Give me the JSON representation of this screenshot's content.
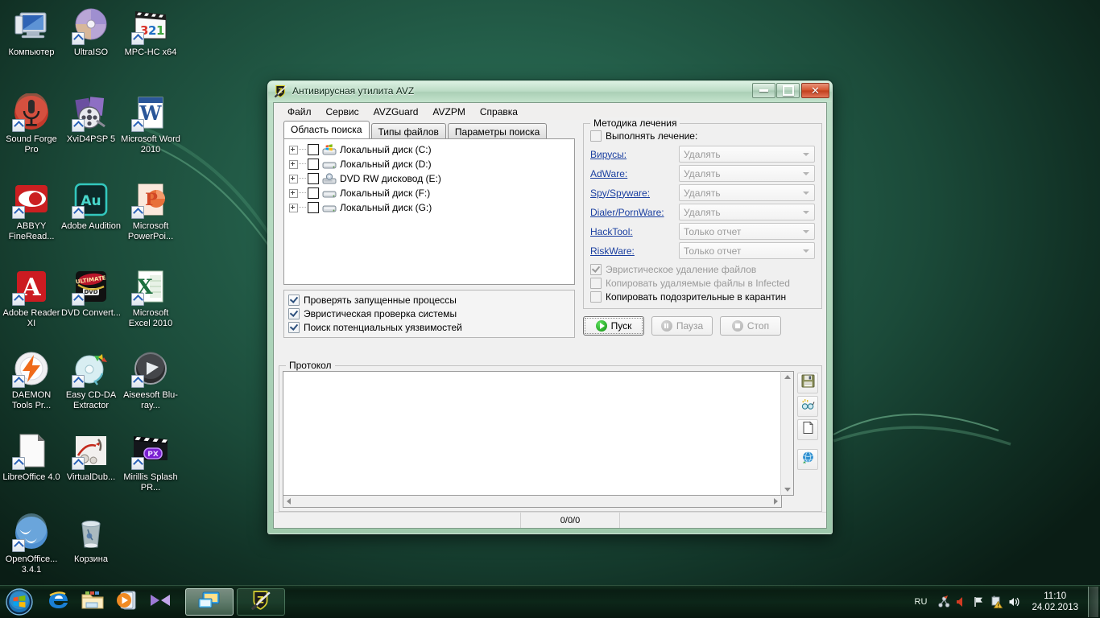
{
  "desktop": {
    "icons": [
      {
        "label": "Компьютер",
        "icon": "computer-icon",
        "shortcut": false
      },
      {
        "label": "UltraISO",
        "icon": "cd-disc-icon",
        "shortcut": true
      },
      {
        "label": "MPC-HC x64",
        "icon": "clapperboard-321-icon",
        "shortcut": true
      },
      {
        "label": "Sound Forge Pro",
        "icon": "microphone-icon",
        "shortcut": true
      },
      {
        "label": "XviD4PSP 5",
        "icon": "film-reel-icon",
        "shortcut": true
      },
      {
        "label": "Microsoft Word 2010",
        "icon": "word-w-icon",
        "shortcut": true
      },
      {
        "label": "ABBYY FineRead...",
        "icon": "abbyy-eye-icon",
        "shortcut": true
      },
      {
        "label": "Adobe Audition",
        "icon": "audition-au-icon",
        "shortcut": true
      },
      {
        "label": "Microsoft PowerPoi...",
        "icon": "powerpoint-p-icon",
        "shortcut": true
      },
      {
        "label": "Adobe Reader XI",
        "icon": "acrobat-a-icon",
        "shortcut": true
      },
      {
        "label": "DVD Convert...",
        "icon": "dvd-box-icon",
        "shortcut": true
      },
      {
        "label": "Microsoft Excel 2010",
        "icon": "excel-x-icon",
        "shortcut": true
      },
      {
        "label": "DAEMON Tools Pr...",
        "icon": "daemon-bolt-icon",
        "shortcut": true
      },
      {
        "label": "Easy CD-DA Extractor",
        "icon": "cd-extract-icon",
        "shortcut": true
      },
      {
        "label": "Aiseesoft Blu-ray...",
        "icon": "play-orb-icon",
        "shortcut": true
      },
      {
        "label": "LibreOffice 4.0",
        "icon": "document-page-icon",
        "shortcut": true
      },
      {
        "label": "VirtualDub...",
        "icon": "virtualdub-icon",
        "shortcut": true
      },
      {
        "label": "Mirillis Splash PR...",
        "icon": "splash-px-icon",
        "shortcut": true
      },
      {
        "label": "OpenOffice... 3.4.1",
        "icon": "openoffice-gulls-icon",
        "shortcut": true
      },
      {
        "label": "Корзина",
        "icon": "recycle-bin-icon",
        "shortcut": false
      }
    ]
  },
  "window": {
    "title": "Антивирусная утилита AVZ",
    "icon": "avz-shield-sword-icon",
    "buttons": {
      "minimize": "minimize-button",
      "maximize": "maximize-button",
      "close": "close-button"
    },
    "menu": [
      "Файл",
      "Сервис",
      "AVZGuard",
      "AVZPM",
      "Справка"
    ],
    "tabs": [
      {
        "label": "Область поиска",
        "active": true
      },
      {
        "label": "Типы файлов",
        "active": false
      },
      {
        "label": "Параметры поиска",
        "active": false
      }
    ],
    "tree": [
      {
        "label": "Локальный диск (C:)",
        "icon": "drive-windows-icon",
        "checked": false
      },
      {
        "label": "Локальный диск (D:)",
        "icon": "drive-icon",
        "checked": false
      },
      {
        "label": "DVD RW дисковод (E:)",
        "icon": "dvd-drive-icon",
        "checked": false
      },
      {
        "label": "Локальный диск (F:)",
        "icon": "drive-icon",
        "checked": false
      },
      {
        "label": "Локальный диск (G:)",
        "icon": "drive-icon",
        "checked": false
      }
    ],
    "scan_options": [
      {
        "label": "Проверять запущенные процессы",
        "checked": true
      },
      {
        "label": "Эвристическая проверка системы",
        "checked": true
      },
      {
        "label": "Поиск потенциальных уязвимостей",
        "checked": true
      }
    ],
    "method": {
      "group_title": "Методика лечения",
      "perform_label": "Выполнять лечение:",
      "perform_checked": false,
      "rows": [
        {
          "label": "Вирусы:",
          "value": "Удалять"
        },
        {
          "label": "AdWare:",
          "value": "Удалять"
        },
        {
          "label": "Spy/Spyware:",
          "value": "Удалять"
        },
        {
          "label": "Dialer/PornWare:",
          "value": "Удалять"
        },
        {
          "label": "HackTool:",
          "value": "Только отчет"
        },
        {
          "label": "RiskWare:",
          "value": "Только отчет"
        }
      ],
      "sub_options": [
        {
          "label": "Эвристическое удаление файлов",
          "checked": true,
          "dim": true
        },
        {
          "label": "Копировать удаляемые файлы в  Infected",
          "checked": false,
          "dim": true
        },
        {
          "label": "Копировать подозрительные в  карантин",
          "checked": false,
          "dim": false
        }
      ]
    },
    "actions": [
      {
        "label": "Пуск",
        "icon": "play-icon",
        "enabled": true
      },
      {
        "label": "Пауза",
        "icon": "pause-icon",
        "enabled": false
      },
      {
        "label": "Стоп",
        "icon": "stop-icon",
        "enabled": false
      }
    ],
    "log": {
      "group_title": "Протокол",
      "text": "",
      "tools": [
        {
          "icon": "save-floppy-icon",
          "name": "save-log-button"
        },
        {
          "icon": "glasses-icon",
          "name": "view-log-button"
        },
        {
          "icon": "blank-page-icon",
          "name": "clear-log-button"
        },
        {
          "icon": "globe-icon",
          "name": "send-log-button"
        }
      ]
    },
    "status": {
      "left": "",
      "center": "0/0/0",
      "right": ""
    }
  },
  "taskbar": {
    "start": "start-orb",
    "quick_launch": [
      {
        "icon": "internet-explorer-icon",
        "name": "taskbar-ie"
      },
      {
        "icon": "explorer-folder-icon",
        "name": "taskbar-explorer"
      },
      {
        "icon": "media-player-icon",
        "name": "taskbar-media-player"
      },
      {
        "icon": "xvid4psp-icon",
        "name": "taskbar-xvid4psp"
      }
    ],
    "windows": [
      {
        "icon": "desktop-window-icon",
        "name": "taskbar-window-explorer",
        "active": true
      },
      {
        "icon": "avz-shield-sword-icon",
        "name": "taskbar-window-avz",
        "active": false
      }
    ],
    "tray": {
      "language": "RU",
      "icons": [
        {
          "icon": "network-icon",
          "name": "tray-network"
        },
        {
          "icon": "volume-mute-icon",
          "name": "tray-volume-red"
        },
        {
          "icon": "flag-icon",
          "name": "tray-action-center"
        },
        {
          "icon": "warning-icon",
          "name": "tray-warning"
        },
        {
          "icon": "speaker-icon",
          "name": "tray-speaker"
        }
      ],
      "time": "11:10",
      "date": "24.02.2013"
    }
  }
}
